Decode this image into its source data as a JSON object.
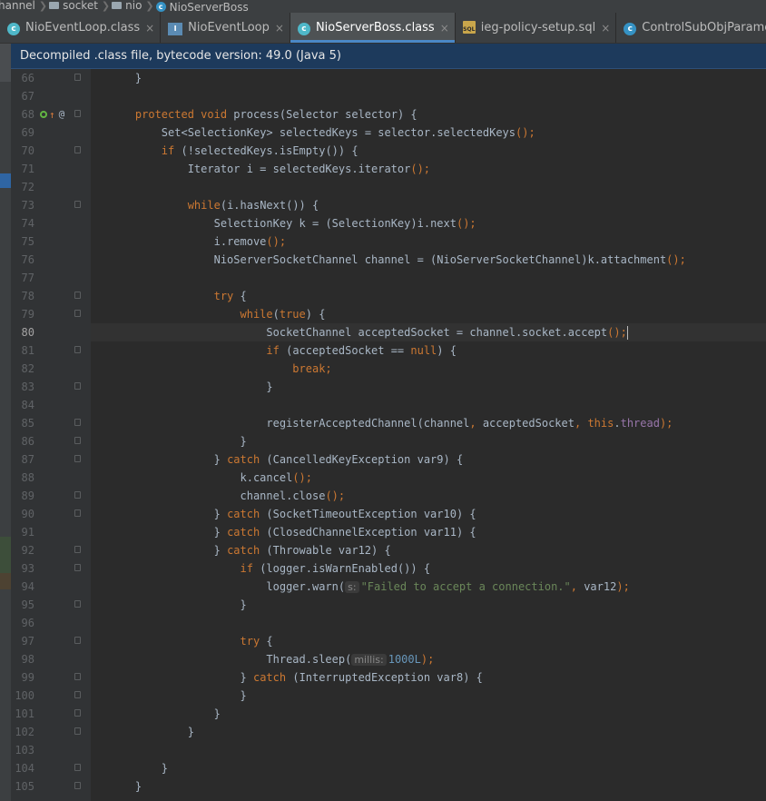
{
  "breadcrumb": [
    {
      "label": "hannel",
      "icon": "folder-icon"
    },
    {
      "label": "socket",
      "icon": "folder-icon"
    },
    {
      "label": "nio",
      "icon": "folder-icon"
    },
    {
      "label": "NioServerBoss",
      "icon": "class-icon"
    }
  ],
  "tabs": [
    {
      "label": "NioEventLoop.class",
      "icon": "class-icon",
      "active": false
    },
    {
      "label": "NioEventLoop",
      "icon": "interface-icon",
      "active": false
    },
    {
      "label": "NioServerBoss.class",
      "icon": "class-icon",
      "active": true
    },
    {
      "label": "ieg-policy-setup.sql",
      "icon": "sql-file-icon",
      "active": false
    },
    {
      "label": "ControlSubObjParame.java",
      "icon": "class-icon",
      "active": false
    }
  ],
  "tab_close_glyph": "×",
  "banner": "Decompiled .class file, bytecode version: 49.0 (Java 5)",
  "colors": {
    "keyword": "#cc7832",
    "string": "#6a8759",
    "number": "#6897bb",
    "field": "#9876aa",
    "text": "#a9b7c6",
    "accent": "#4a88c7"
  },
  "current_line": 80,
  "code_lines": [
    {
      "n": "66",
      "t": "    }"
    },
    {
      "n": "67",
      "t": ""
    },
    {
      "n": "68",
      "t": "    protected void process(Selector selector) {"
    },
    {
      "n": "69",
      "t": "        Set<SelectionKey> selectedKeys = selector.selectedKeys();"
    },
    {
      "n": "70",
      "t": "        if (!selectedKeys.isEmpty()) {"
    },
    {
      "n": "71",
      "t": "            Iterator i = selectedKeys.iterator();"
    },
    {
      "n": "72",
      "t": ""
    },
    {
      "n": "73",
      "t": "            while(i.hasNext()) {"
    },
    {
      "n": "74",
      "t": "                SelectionKey k = (SelectionKey)i.next();"
    },
    {
      "n": "75",
      "t": "                i.remove();"
    },
    {
      "n": "76",
      "t": "                NioServerSocketChannel channel = (NioServerSocketChannel)k.attachment();"
    },
    {
      "n": "77",
      "t": ""
    },
    {
      "n": "78",
      "t": "                try {"
    },
    {
      "n": "79",
      "t": "                    while(true) {"
    },
    {
      "n": "80",
      "t": "                        SocketChannel acceptedSocket = channel.socket.accept();"
    },
    {
      "n": "81",
      "t": "                        if (acceptedSocket == null) {"
    },
    {
      "n": "82",
      "t": "                            break;"
    },
    {
      "n": "83",
      "t": "                        }"
    },
    {
      "n": "84",
      "t": ""
    },
    {
      "n": "85",
      "t": "                        registerAcceptedChannel(channel, acceptedSocket, this.thread);"
    },
    {
      "n": "86",
      "t": "                    }"
    },
    {
      "n": "87",
      "t": "                } catch (CancelledKeyException var9) {"
    },
    {
      "n": "88",
      "t": "                    k.cancel();"
    },
    {
      "n": "89",
      "t": "                    channel.close();"
    },
    {
      "n": "90",
      "t": "                } catch (SocketTimeoutException var10) {"
    },
    {
      "n": "91",
      "t": "                } catch (ClosedChannelException var11) {"
    },
    {
      "n": "92",
      "t": "                } catch (Throwable var12) {"
    },
    {
      "n": "93",
      "t": "                    if (logger.isWarnEnabled()) {"
    },
    {
      "n": "94",
      "t": "                        logger.warn( s: \"Failed to accept a connection.\", var12);"
    },
    {
      "n": "95",
      "t": "                    }"
    },
    {
      "n": "96",
      "t": ""
    },
    {
      "n": "97",
      "t": "                    try {"
    },
    {
      "n": "98",
      "t": "                        Thread.sleep( millis: 1000L);"
    },
    {
      "n": "99",
      "t": "                    } catch (InterruptedException var8) {"
    },
    {
      "n": "100",
      "t": "                    }"
    },
    {
      "n": "101",
      "t": "                }"
    },
    {
      "n": "102",
      "t": "            }"
    },
    {
      "n": "103",
      "t": ""
    },
    {
      "n": "104",
      "t": "        }"
    },
    {
      "n": "105",
      "t": "    }"
    }
  ]
}
